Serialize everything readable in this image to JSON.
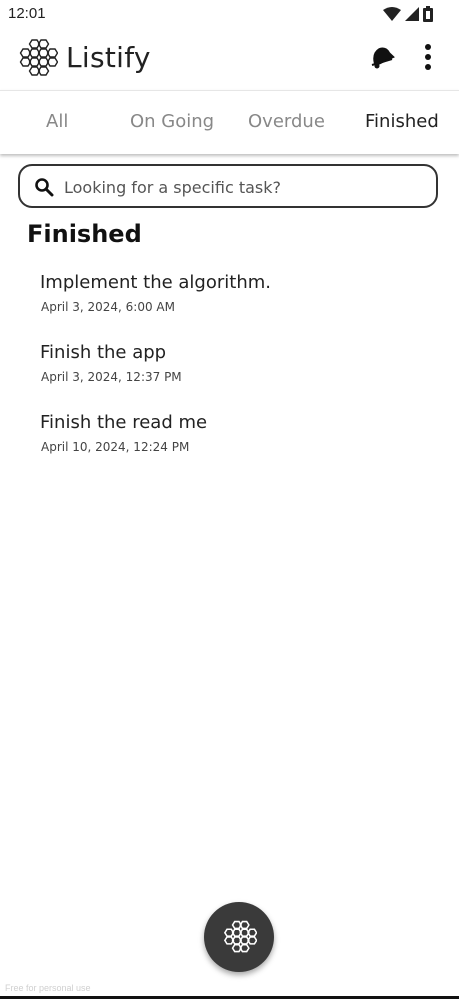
{
  "status_bar": {
    "time": "12:01"
  },
  "app_bar": {
    "title": "Listify",
    "icons": [
      "logo-icon",
      "bell-icon",
      "more-vert-icon"
    ]
  },
  "tabs": [
    {
      "label": "All",
      "active": false
    },
    {
      "label": "On Going",
      "active": false
    },
    {
      "label": "Overdue",
      "active": false
    },
    {
      "label": "Finished",
      "active": true
    }
  ],
  "search": {
    "placeholder": "Looking for a specific task?"
  },
  "section": {
    "title": "Finished"
  },
  "tasks": [
    {
      "title": "Implement the algorithm.",
      "date": "April 3, 2024, 6:00 AM"
    },
    {
      "title": "Finish the app",
      "date": "April 3, 2024, 12:37 PM"
    },
    {
      "title": "Finish the read me",
      "date": "April 10, 2024, 12:24 PM"
    }
  ],
  "fab": {
    "icon": "hexagon-cluster-icon"
  },
  "footer": {
    "watermark": "Free for personal use"
  },
  "colors": {
    "background": "#ffffff",
    "text": "#111111",
    "tab_inactive": "#888888",
    "fab": "#3a3a3a"
  }
}
